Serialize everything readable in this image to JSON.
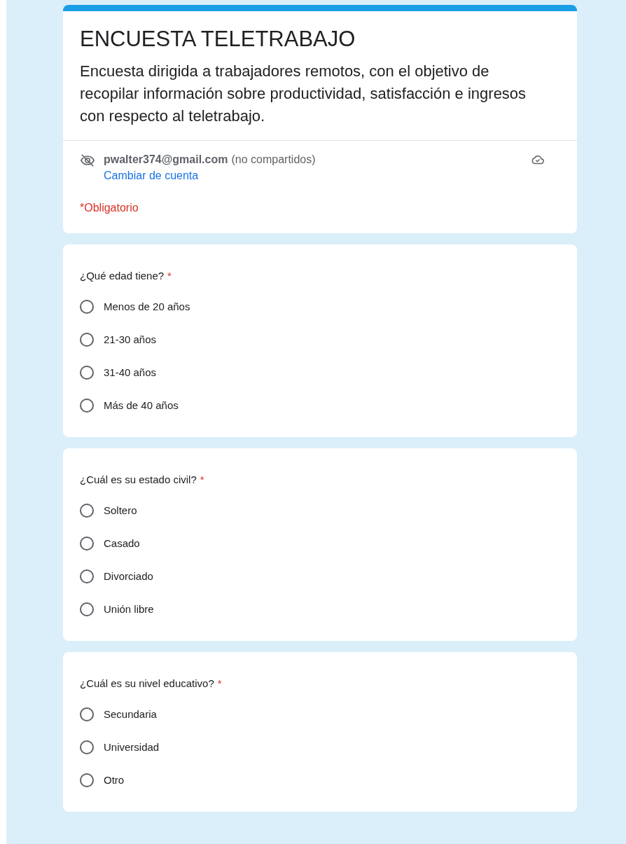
{
  "form": {
    "title": "ENCUESTA TELETRABAJO",
    "description": "Encuesta dirigida a trabajadores remotos, con el objetivo de recopilar información sobre productividad, satisfacción e ingresos con respecto al teletrabajo.",
    "account": "pwalter374@gmail.com",
    "sharing_note": "(no compartidos)",
    "switch_account": "Cambiar de cuenta",
    "required_note": "*Obligatorio"
  },
  "questions": [
    {
      "title": "¿Qué edad tiene?",
      "required_mark": "*",
      "options": [
        {
          "label": "Menos de 20 años",
          "selected": false
        },
        {
          "label": "21-30 años",
          "selected": false
        },
        {
          "label": "31-40 años",
          "selected": false
        },
        {
          "label": "Más de 40 años",
          "selected": false
        }
      ]
    },
    {
      "title": "¿Cuál es su estado civil?",
      "required_mark": "*",
      "options": [
        {
          "label": "Soltero",
          "selected": false
        },
        {
          "label": "Casado",
          "selected": false
        },
        {
          "label": "Divorciado",
          "selected": false
        },
        {
          "label": "Unión libre",
          "selected": false
        }
      ]
    },
    {
      "title": "¿Cuál es su nivel educativo?",
      "required_mark": "*",
      "options": [
        {
          "label": "Secundaria",
          "selected": false
        },
        {
          "label": "Universidad",
          "selected": false
        },
        {
          "label": "Otro",
          "selected": false
        }
      ]
    }
  ]
}
